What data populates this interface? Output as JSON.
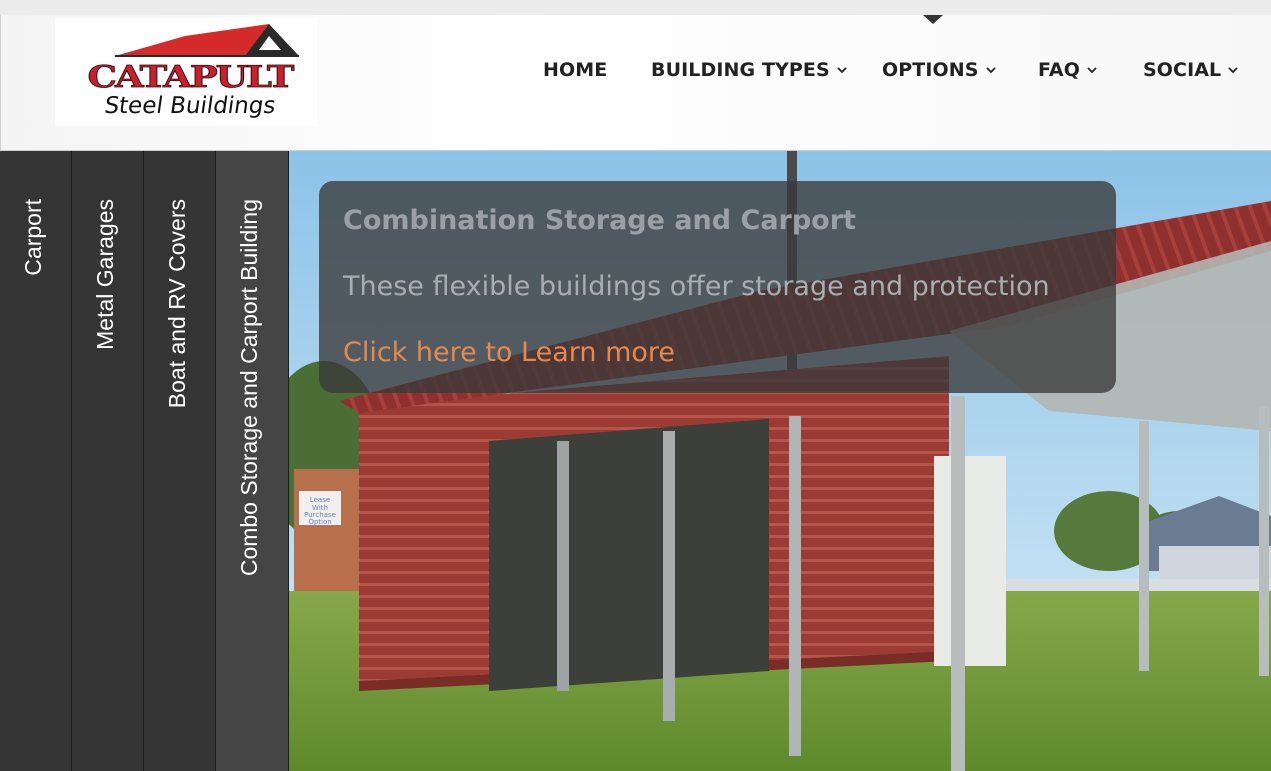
{
  "logo": {
    "word": "CATAPULT",
    "sub": "Steel Buildings"
  },
  "nav": {
    "items": [
      {
        "label": "HOME",
        "dropdown": false
      },
      {
        "label": "BUILDING TYPES",
        "dropdown": true
      },
      {
        "label": "OPTIONS",
        "dropdown": true
      },
      {
        "label": "FAQ",
        "dropdown": true
      },
      {
        "label": "SOCIAL",
        "dropdown": true
      }
    ]
  },
  "tabs": [
    {
      "label": "Carport",
      "active": false
    },
    {
      "label": "Metal Garages",
      "active": false
    },
    {
      "label": "Boat and RV Covers",
      "active": false
    },
    {
      "label": "Combo Storage and Carport Building",
      "active": true
    }
  ],
  "slide": {
    "title": "Combination Storage and Carport",
    "text": "These flexible buildings offer storage and protection",
    "link": "Click here to Learn more"
  },
  "hero_sign": [
    "Lease",
    "With",
    "Purchase",
    "Option"
  ],
  "colors": {
    "accent_link": "#e58a4f",
    "tab_bg": "#353535",
    "brand_red": "#c8202c"
  }
}
